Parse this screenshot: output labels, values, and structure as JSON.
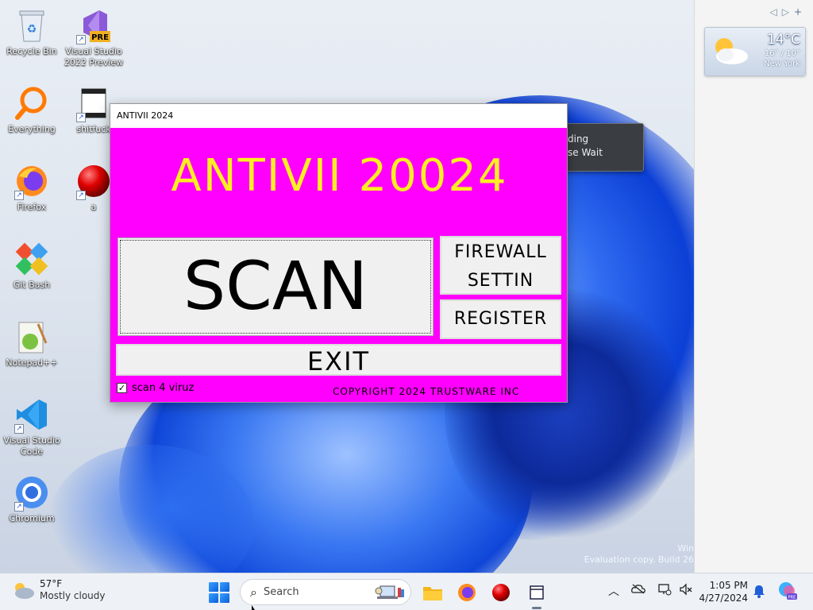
{
  "desktop": {
    "icons": [
      {
        "label": "Recycle Bin",
        "icon": "recycle-bin-icon",
        "shortcut": false
      },
      {
        "label": "Visual Studio\n2022 Preview",
        "icon": "visual-studio-preview-icon",
        "shortcut": true,
        "badge": "PRE"
      },
      {
        "label": "Everything",
        "icon": "everything-search-icon",
        "shortcut": false
      },
      {
        "label": "shitfuck",
        "icon": "film-document-icon",
        "shortcut": true
      },
      {
        "label": "Firefox",
        "icon": "firefox-icon",
        "shortcut": true
      },
      {
        "label": "a",
        "icon": "red-ball-icon",
        "shortcut": true
      },
      {
        "label": "Git Bash",
        "icon": "git-bash-icon",
        "shortcut": false
      },
      {
        "label": "Notepad++",
        "icon": "notepad-plus-plus-icon",
        "shortcut": false
      },
      {
        "label": "Visual Studio\nCode",
        "icon": "vscode-icon",
        "shortcut": true
      },
      {
        "label": "Chromium",
        "icon": "chromium-icon",
        "shortcut": true
      }
    ],
    "watermark": {
      "line1": "Win",
      "line2": "Evaluation copy. Build 26"
    }
  },
  "gadget": {
    "temp": "14°C",
    "range": "16° / 10°",
    "city": "New York"
  },
  "loading_popup": {
    "line1": "ding",
    "line2": "se Wait"
  },
  "app": {
    "window_title": "ANTIVII 2024",
    "heading": "ANTIVII 20024",
    "scan_label": "SCAN",
    "firewall_label": "FIREWALL\nSETTIN",
    "register_label": "REGISTER",
    "exit_label": "EXIT",
    "checkbox_label": "scan 4 viruz",
    "checkbox_checked": true,
    "copyright": "COPYRIGHT 2024 TRUSTWARE INC",
    "bg_color": "#ff00ff",
    "heading_color": "#ffee22"
  },
  "taskbar": {
    "weather_temp": "57°F",
    "weather_desc": "Mostly cloudy",
    "search_placeholder": "Search",
    "time": "1:05 PM",
    "date": "4/27/2024",
    "pinned": [
      "start-icon",
      "file-explorer-icon",
      "firefox-icon",
      "red-ball-icon",
      "antivii-app-icon"
    ],
    "tray": [
      "chevron-up-icon",
      "onedrive-icon",
      "network-icon",
      "volume-muted-icon",
      "notification-bell-icon",
      "copilot-icon"
    ]
  }
}
